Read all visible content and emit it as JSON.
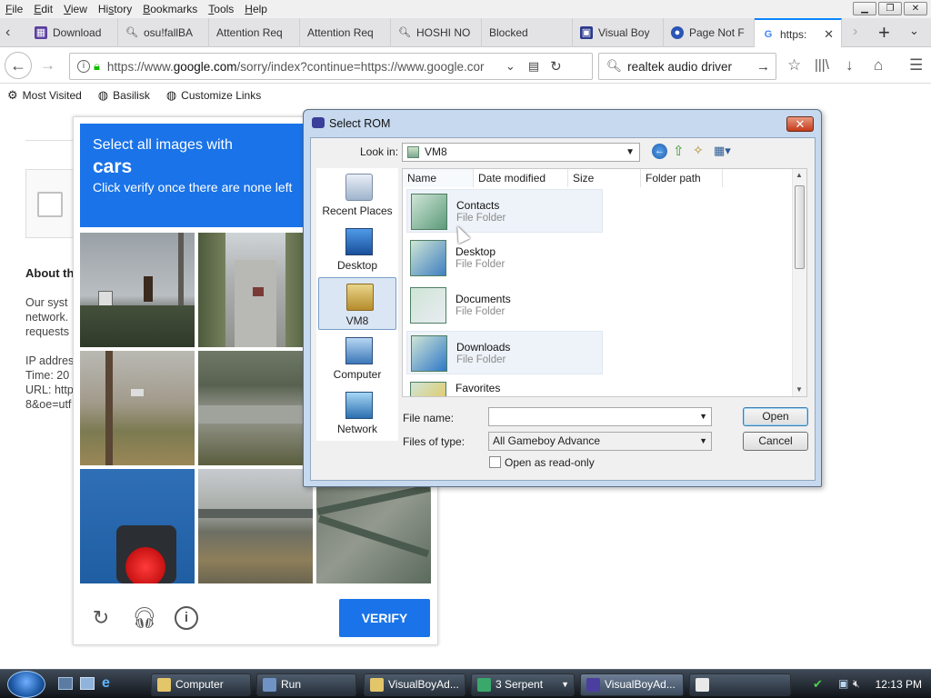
{
  "menubar": {
    "items": [
      "File",
      "Edit",
      "View",
      "History",
      "Bookmarks",
      "Tools",
      "Help"
    ],
    "accel": [
      "F",
      "E",
      "V",
      "s",
      "B",
      "T",
      "H"
    ]
  },
  "tabs": [
    {
      "label": "Download"
    },
    {
      "label": "osu!fallBA"
    },
    {
      "label": "Attention Req"
    },
    {
      "label": "Attention Req"
    },
    {
      "label": "HOSHI NO"
    },
    {
      "label": "Blocked"
    },
    {
      "label": "Visual Boy"
    },
    {
      "label": "Page Not F"
    },
    {
      "label": "https:"
    }
  ],
  "navbar": {
    "url_prefix": "https://www.",
    "url_domain": "google.com",
    "url_rest": "/sorry/index?continue=https://www.google.cor",
    "search_value": "realtek audio driver"
  },
  "bookmarks": [
    "Most Visited",
    "Basilisk",
    "Customize Links"
  ],
  "page": {
    "about_heading": "About th",
    "lines": [
      "Our syst",
      "network.",
      "requests"
    ],
    "ip_lines": [
      "IP addres",
      "Time: 20",
      "URL: http",
      "8&oe=utf"
    ]
  },
  "captcha": {
    "instruction": "Select all images with",
    "target": "cars",
    "hint": "Click verify once there are none left",
    "verify_label": "VERIFY"
  },
  "dialog": {
    "title": "Select ROM",
    "look_in_label": "Look in:",
    "look_in_value": "VM8",
    "places": [
      "Recent Places",
      "Desktop",
      "VM8",
      "Computer",
      "Network"
    ],
    "columns": [
      "Name",
      "Date modified",
      "Size",
      "Folder path"
    ],
    "files": [
      {
        "name": "Contacts",
        "type": "File Folder"
      },
      {
        "name": "Desktop",
        "type": "File Folder"
      },
      {
        "name": "Documents",
        "type": "File Folder"
      },
      {
        "name": "Downloads",
        "type": "File Folder"
      },
      {
        "name": "Favorites",
        "type": ""
      }
    ],
    "file_name_label": "File name:",
    "file_name_value": "",
    "files_of_type_label": "Files of type:",
    "files_of_type_value": "All Gameboy Advance",
    "readonly_label": "Open as read-only",
    "open_label": "Open",
    "cancel_label": "Cancel"
  },
  "taskbar": {
    "items": [
      "Computer",
      "Run",
      "VisualBoyAd...",
      "3 Serpent",
      "VisualBoyAd...",
      ""
    ],
    "clock": "12:13 PM"
  },
  "colors": {
    "accent": "#1a73e8",
    "firefox_tab_accent": "#0a84ff",
    "lock_green": "#12bc00"
  }
}
